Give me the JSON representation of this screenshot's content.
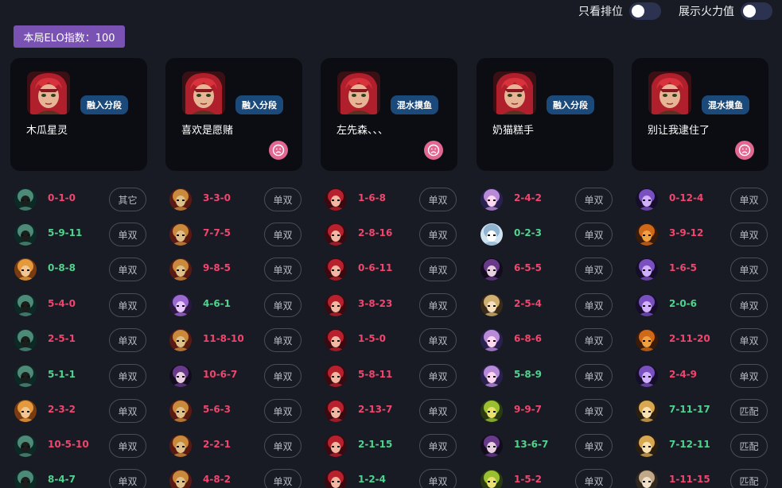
{
  "toggles": [
    {
      "label": "只看排位",
      "on": false
    },
    {
      "label": "展示火力值",
      "on": false
    }
  ],
  "elo": {
    "text": "本局ELO指数：100"
  },
  "players": [
    {
      "name": "木瓜星灵",
      "tier": "融入分段",
      "sad": false
    },
    {
      "name": "喜欢是愿赌",
      "tier": "融入分段",
      "sad": true
    },
    {
      "name": "左先森、、、",
      "tier": "混水摸鱼",
      "sad": true
    },
    {
      "name": "奶猫糕手",
      "tier": "融入分段",
      "sad": false
    },
    {
      "name": "别让我逮住了",
      "tier": "混水摸鱼",
      "sad": true
    }
  ],
  "colors": {
    "red": "#f0466e",
    "green": "#4fd38e",
    "purple": "#7a52b3",
    "badge": "#1b4a7a",
    "sad": "#e26891"
  },
  "match_history": [
    [
      {
        "kda": "0-1-0",
        "result": "red",
        "mode": "其它",
        "champ": "teal-helm"
      },
      {
        "kda": "5-9-11",
        "result": "green",
        "mode": "单双",
        "champ": "teal-helm"
      },
      {
        "kda": "0-8-8",
        "result": "green",
        "mode": "单双",
        "champ": "orange-hair"
      },
      {
        "kda": "5-4-0",
        "result": "red",
        "mode": "单双",
        "champ": "teal-helm"
      },
      {
        "kda": "2-5-1",
        "result": "red",
        "mode": "单双",
        "champ": "teal-helm"
      },
      {
        "kda": "5-1-1",
        "result": "green",
        "mode": "单双",
        "champ": "teal-helm"
      },
      {
        "kda": "2-3-2",
        "result": "red",
        "mode": "单双",
        "champ": "orange-hair"
      },
      {
        "kda": "10-5-10",
        "result": "red",
        "mode": "单双",
        "champ": "teal-helm"
      },
      {
        "kda": "8-4-7",
        "result": "green",
        "mode": "单双",
        "champ": "teal-helm"
      }
    ],
    [
      {
        "kda": "3-3-0",
        "result": "red",
        "mode": "单双",
        "champ": "red-mask"
      },
      {
        "kda": "7-7-5",
        "result": "red",
        "mode": "单双",
        "champ": "red-mask"
      },
      {
        "kda": "9-8-5",
        "result": "red",
        "mode": "单双",
        "champ": "red-mask"
      },
      {
        "kda": "4-6-1",
        "result": "green",
        "mode": "单双",
        "champ": "purple-mage"
      },
      {
        "kda": "11-8-10",
        "result": "red",
        "mode": "单双",
        "champ": "red-mask"
      },
      {
        "kda": "10-6-7",
        "result": "red",
        "mode": "单双",
        "champ": "dark-lady"
      },
      {
        "kda": "5-6-3",
        "result": "red",
        "mode": "单双",
        "champ": "red-mask"
      },
      {
        "kda": "2-2-1",
        "result": "red",
        "mode": "单双",
        "champ": "red-mask"
      },
      {
        "kda": "4-8-2",
        "result": "red",
        "mode": "单双",
        "champ": "red-mask"
      }
    ],
    [
      {
        "kda": "1-6-8",
        "result": "red",
        "mode": "单双",
        "champ": "red-hair"
      },
      {
        "kda": "2-8-16",
        "result": "red",
        "mode": "单双",
        "champ": "red-hair"
      },
      {
        "kda": "0-6-11",
        "result": "red",
        "mode": "单双",
        "champ": "red-hair"
      },
      {
        "kda": "3-8-23",
        "result": "red",
        "mode": "单双",
        "champ": "red-hair"
      },
      {
        "kda": "1-5-0",
        "result": "red",
        "mode": "单双",
        "champ": "red-hair"
      },
      {
        "kda": "5-8-11",
        "result": "red",
        "mode": "单双",
        "champ": "red-hair"
      },
      {
        "kda": "2-13-7",
        "result": "red",
        "mode": "单双",
        "champ": "red-hair"
      },
      {
        "kda": "2-1-15",
        "result": "green",
        "mode": "单双",
        "champ": "red-hair"
      },
      {
        "kda": "1-2-4",
        "result": "green",
        "mode": "单双",
        "champ": "red-hair"
      }
    ],
    [
      {
        "kda": "2-4-2",
        "result": "red",
        "mode": "单双",
        "champ": "purple-fairy"
      },
      {
        "kda": "0-2-3",
        "result": "green",
        "mode": "单双",
        "champ": "ice-spirit"
      },
      {
        "kda": "6-5-5",
        "result": "red",
        "mode": "单双",
        "champ": "dark-lady"
      },
      {
        "kda": "2-5-4",
        "result": "red",
        "mode": "单双",
        "champ": "gold-mage"
      },
      {
        "kda": "6-8-6",
        "result": "red",
        "mode": "单双",
        "champ": "purple-fairy"
      },
      {
        "kda": "5-8-9",
        "result": "green",
        "mode": "单双",
        "champ": "purple-fairy"
      },
      {
        "kda": "9-9-7",
        "result": "red",
        "mode": "单双",
        "champ": "green-sprite"
      },
      {
        "kda": "13-6-7",
        "result": "green",
        "mode": "单双",
        "champ": "dark-lady"
      },
      {
        "kda": "1-5-2",
        "result": "red",
        "mode": "单双",
        "champ": "green-sprite"
      }
    ],
    [
      {
        "kda": "0-12-4",
        "result": "red",
        "mode": "单双",
        "champ": "void-purple"
      },
      {
        "kda": "3-9-12",
        "result": "red",
        "mode": "单双",
        "champ": "orange-beast"
      },
      {
        "kda": "1-6-5",
        "result": "red",
        "mode": "单双",
        "champ": "void-purple"
      },
      {
        "kda": "2-0-6",
        "result": "green",
        "mode": "单双",
        "champ": "void-purple"
      },
      {
        "kda": "2-11-20",
        "result": "red",
        "mode": "单双",
        "champ": "orange-beast"
      },
      {
        "kda": "2-4-9",
        "result": "red",
        "mode": "单双",
        "champ": "void-purple"
      },
      {
        "kda": "7-11-17",
        "result": "green",
        "mode": "匹配",
        "champ": "gold-armor"
      },
      {
        "kda": "7-12-11",
        "result": "green",
        "mode": "匹配",
        "champ": "gold-armor"
      },
      {
        "kda": "1-11-15",
        "result": "red",
        "mode": "匹配",
        "champ": "pale-knight"
      }
    ]
  ]
}
